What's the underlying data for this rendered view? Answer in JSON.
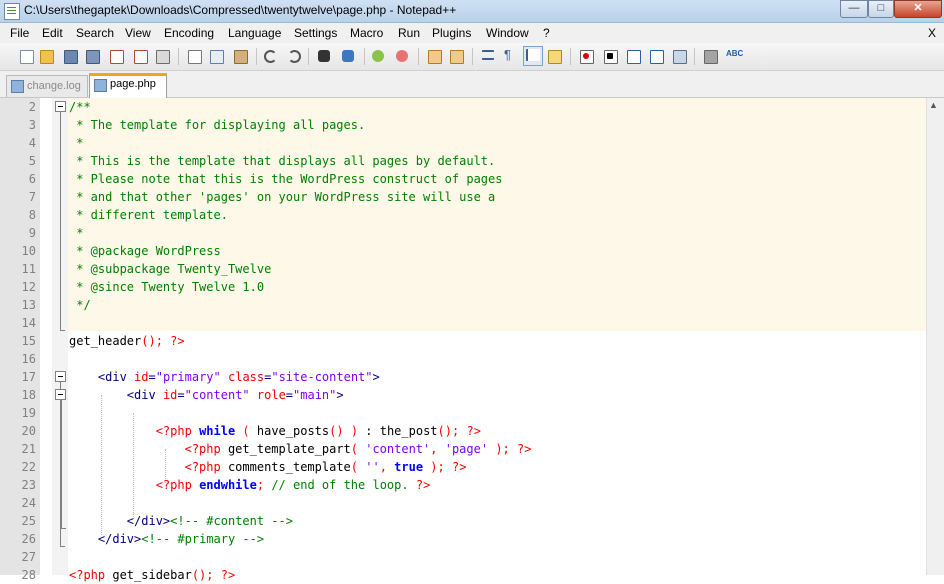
{
  "window": {
    "title": "C:\\Users\\thegaptek\\Downloads\\Compressed\\twentytwelve\\page.php - Notepad++",
    "buttons": {
      "minimize": "—",
      "maximize": "□",
      "close": "✕"
    }
  },
  "menu": {
    "items": [
      "File",
      "Edit",
      "Search",
      "View",
      "Encoding",
      "Language",
      "Settings",
      "Macro",
      "Run",
      "Plugins",
      "Window",
      "?"
    ],
    "close": "X"
  },
  "toolbar": {
    "icons": [
      "new-file",
      "open-file",
      "save",
      "save-all",
      "close",
      "close-all",
      "print",
      "cut",
      "copy",
      "paste",
      "undo",
      "redo",
      "find",
      "replace",
      "zoom-in",
      "zoom-out",
      "sync-vertical",
      "sync-horizontal",
      "word-wrap",
      "show-all-characters",
      "indent-guide",
      "user-defined-language",
      "record-macro",
      "stop-macro",
      "play-macro",
      "run-macro-multiple",
      "save-macro",
      "spell-check-settings",
      "spell-check"
    ],
    "colors": {
      "accent": "#f7a21b",
      "selection": "#7da2ce"
    }
  },
  "tabs": [
    {
      "label": "change.log",
      "active": false
    },
    {
      "label": "page.php",
      "active": true
    }
  ],
  "editor": {
    "lines": [
      {
        "n": "2",
        "t": [
          [
            "c",
            "/**"
          ]
        ]
      },
      {
        "n": "3",
        "t": [
          [
            "c",
            " * The template for displaying all pages."
          ]
        ]
      },
      {
        "n": "4",
        "t": [
          [
            "c",
            " *"
          ]
        ]
      },
      {
        "n": "5",
        "t": [
          [
            "c",
            " * This is the template that displays all pages by default."
          ]
        ]
      },
      {
        "n": "6",
        "t": [
          [
            "c",
            " * Please note that this is the WordPress construct of pages"
          ]
        ]
      },
      {
        "n": "7",
        "t": [
          [
            "c",
            " * and that other 'pages' on your WordPress site will use a"
          ]
        ]
      },
      {
        "n": "8",
        "t": [
          [
            "c",
            " * different template."
          ]
        ]
      },
      {
        "n": "9",
        "t": [
          [
            "c",
            " *"
          ]
        ]
      },
      {
        "n": "10",
        "t": [
          [
            "c",
            " * @package WordPress"
          ]
        ]
      },
      {
        "n": "11",
        "t": [
          [
            "c",
            " * @subpackage Twenty_Twelve"
          ]
        ]
      },
      {
        "n": "12",
        "t": [
          [
            "c",
            " * @since Twenty Twelve 1.0"
          ]
        ]
      },
      {
        "n": "13",
        "t": [
          [
            "c",
            " */"
          ]
        ]
      },
      {
        "n": "14",
        "t": []
      },
      {
        "n": "15",
        "t": [
          [
            "",
            "get_header"
          ],
          [
            "p",
            "();"
          ],
          [
            "",
            " "
          ],
          [
            "a",
            "?>"
          ]
        ]
      },
      {
        "n": "16",
        "t": []
      },
      {
        "n": "17",
        "t": [
          [
            "",
            "    "
          ],
          [
            "k",
            "<div"
          ],
          [
            "",
            " "
          ],
          [
            "a",
            "id"
          ],
          [
            "k",
            "="
          ],
          [
            "s",
            "\"primary\""
          ],
          [
            "",
            " "
          ],
          [
            "a",
            "class"
          ],
          [
            "k",
            "="
          ],
          [
            "s",
            "\"site-content\""
          ],
          [
            "k",
            ">"
          ]
        ]
      },
      {
        "n": "18",
        "t": [
          [
            "",
            "        "
          ],
          [
            "k",
            "<div"
          ],
          [
            "",
            " "
          ],
          [
            "a",
            "id"
          ],
          [
            "k",
            "="
          ],
          [
            "s",
            "\"content\""
          ],
          [
            "",
            " "
          ],
          [
            "a",
            "role"
          ],
          [
            "k",
            "="
          ],
          [
            "s",
            "\"main\""
          ],
          [
            "k",
            ">"
          ]
        ]
      },
      {
        "n": "19",
        "t": []
      },
      {
        "n": "20",
        "t": [
          [
            "",
            "            "
          ],
          [
            "a",
            "<?php"
          ],
          [
            "",
            " "
          ],
          [
            "bl",
            "while"
          ],
          [
            "",
            " "
          ],
          [
            "p",
            "("
          ],
          [
            "",
            " have_posts"
          ],
          [
            "p",
            "()"
          ],
          [
            "",
            " "
          ],
          [
            "p",
            ")"
          ],
          [
            "",
            " : the_post"
          ],
          [
            "p",
            "();"
          ],
          [
            "",
            " "
          ],
          [
            "a",
            "?>"
          ]
        ]
      },
      {
        "n": "21",
        "t": [
          [
            "",
            "                "
          ],
          [
            "a",
            "<?php"
          ],
          [
            "",
            " get_template_part"
          ],
          [
            "p",
            "("
          ],
          [
            "",
            " "
          ],
          [
            "s",
            "'content'"
          ],
          [
            "p",
            ","
          ],
          [
            "",
            " "
          ],
          [
            "s",
            "'page'"
          ],
          [
            "",
            " "
          ],
          [
            "p",
            ");"
          ],
          [
            "",
            " "
          ],
          [
            "a",
            "?>"
          ]
        ]
      },
      {
        "n": "22",
        "t": [
          [
            "",
            "                "
          ],
          [
            "a",
            "<?php"
          ],
          [
            "",
            " comments_template"
          ],
          [
            "p",
            "("
          ],
          [
            "",
            " "
          ],
          [
            "s",
            "''"
          ],
          [
            "p",
            ","
          ],
          [
            "",
            " "
          ],
          [
            "bl",
            "true"
          ],
          [
            "",
            " "
          ],
          [
            "p",
            ");"
          ],
          [
            "",
            " "
          ],
          [
            "a",
            "?>"
          ]
        ]
      },
      {
        "n": "23",
        "t": [
          [
            "",
            "            "
          ],
          [
            "a",
            "<?php"
          ],
          [
            "",
            " "
          ],
          [
            "bl",
            "endwhile"
          ],
          [
            "p",
            ";"
          ],
          [
            "",
            " "
          ],
          [
            "c",
            "// end of the loop."
          ],
          [
            "",
            " "
          ],
          [
            "a",
            "?>"
          ]
        ]
      },
      {
        "n": "24",
        "t": []
      },
      {
        "n": "25",
        "t": [
          [
            "",
            "        "
          ],
          [
            "k",
            "</div>"
          ],
          [
            "c",
            "<!-- #content -->"
          ]
        ]
      },
      {
        "n": "26",
        "t": [
          [
            "",
            "    "
          ],
          [
            "k",
            "</div>"
          ],
          [
            "c",
            "<!-- #primary -->"
          ]
        ]
      },
      {
        "n": "27",
        "t": []
      },
      {
        "n": "28",
        "t": [
          [
            "a",
            "<?php"
          ],
          [
            "",
            " get_sidebar"
          ],
          [
            "p",
            "();"
          ],
          [
            "",
            " "
          ],
          [
            "a",
            "?>"
          ]
        ]
      }
    ]
  }
}
